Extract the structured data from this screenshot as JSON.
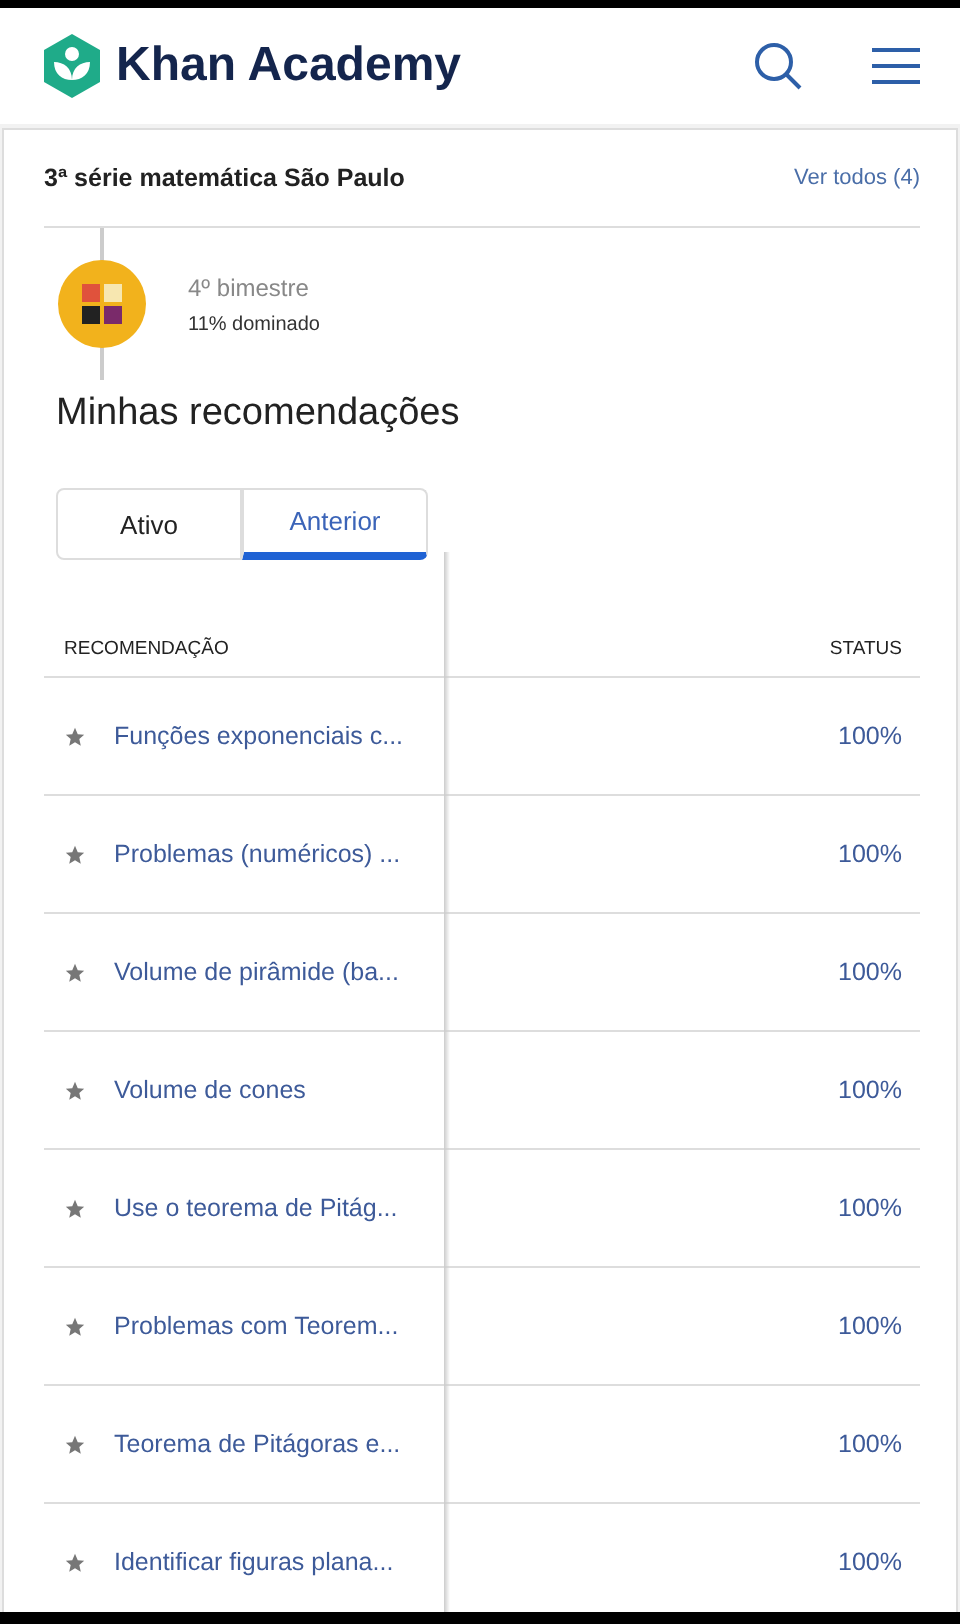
{
  "header": {
    "logo_text": "Khan Academy"
  },
  "course": {
    "title": "3ª série matemática São Paulo",
    "link": "Ver todos (4)"
  },
  "unit": {
    "name": "4º bimestre",
    "progress": "11% dominado"
  },
  "section_title": "Minhas recomendações",
  "tabs": [
    {
      "label": "Ativo",
      "selected": false
    },
    {
      "label": "Anterior",
      "selected": true
    }
  ],
  "table": {
    "columns": [
      "RECOMENDAÇÃO",
      "STATUS"
    ],
    "rows": [
      {
        "name": "Funções exponenciais c...",
        "status": "100%"
      },
      {
        "name": "Problemas (numéricos) ...",
        "status": "100%"
      },
      {
        "name": "Volume de pirâmide (ba...",
        "status": "100%"
      },
      {
        "name": "Volume de cones",
        "status": "100%"
      },
      {
        "name": "Use o teorema de Pitág...",
        "status": "100%"
      },
      {
        "name": "Problemas com Teorem...",
        "status": "100%"
      },
      {
        "name": "Teorema de Pitágoras e...",
        "status": "100%"
      },
      {
        "name": "Identificar figuras plana...",
        "status": "100%"
      }
    ]
  }
}
